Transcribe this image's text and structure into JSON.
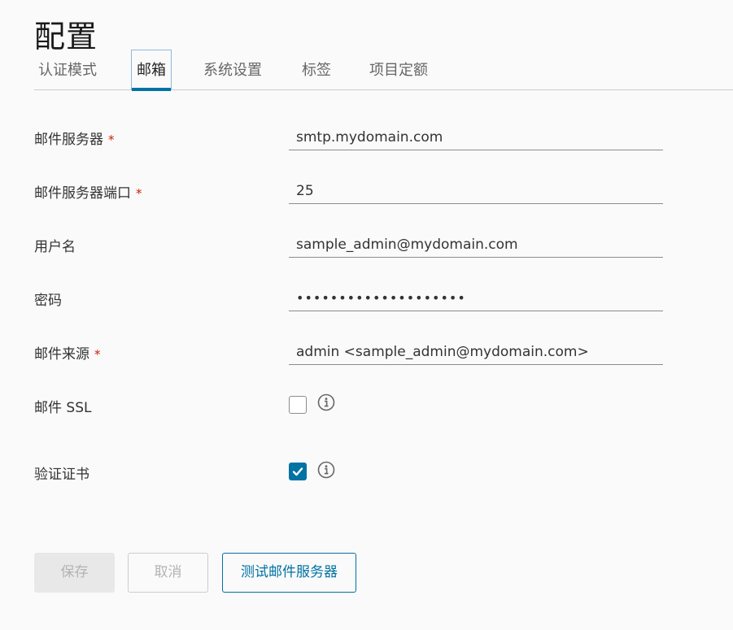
{
  "page": {
    "title": "配置"
  },
  "tabs": [
    {
      "label": "认证模式",
      "active": false
    },
    {
      "label": "邮箱",
      "active": true
    },
    {
      "label": "系统设置",
      "active": false
    },
    {
      "label": "标签",
      "active": false
    },
    {
      "label": "项目定额",
      "active": false
    }
  ],
  "form": {
    "mail_server": {
      "label": "邮件服务器",
      "required": "*",
      "value": "smtp.mydomain.com"
    },
    "mail_port": {
      "label": "邮件服务器端口",
      "required": "*",
      "value": "25"
    },
    "username": {
      "label": "用户名",
      "value": "sample_admin@mydomain.com"
    },
    "password": {
      "label": "密码",
      "value": "••••••••••••••••••••"
    },
    "mail_from": {
      "label": "邮件来源",
      "required": "*",
      "value": "admin <sample_admin@mydomain.com>"
    },
    "mail_ssl": {
      "label": "邮件 SSL",
      "checked": false,
      "icon": "info-icon"
    },
    "verify_cert": {
      "label": "验证证书",
      "checked": true,
      "icon": "info-icon"
    }
  },
  "buttons": {
    "save": "保存",
    "cancel": "取消",
    "test": "测试邮件服务器"
  },
  "colors": {
    "accent": "#0072a3",
    "required": "#c92100",
    "disabled_text": "#b3b3b3"
  }
}
